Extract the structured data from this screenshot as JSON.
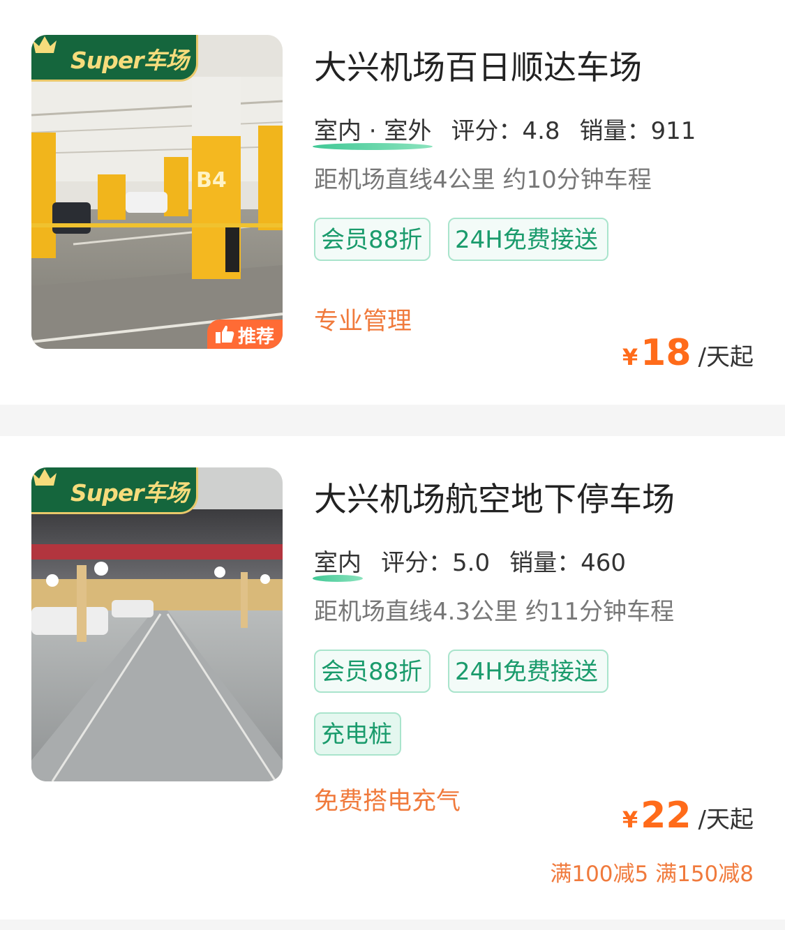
{
  "lots": [
    {
      "name": "大兴机场百日顺达车场",
      "badge": "Super车场",
      "recommend": "推荐",
      "env": "室内 · 室外",
      "rating_label": "评分：4.8",
      "sales_label": "销量：911",
      "distance": "距机场直线4公里 约10分钟车程",
      "tags": [
        "会员88折",
        "24H免费接送"
      ],
      "highlight": "专业管理",
      "currency": "¥",
      "price": "18",
      "price_unit": "/天起"
    },
    {
      "name": "大兴机场航空地下停车场",
      "badge": "Super车场",
      "env": "室内",
      "rating_label": "评分：5.0",
      "sales_label": "销量：460",
      "distance": "距机场直线4.3公里 约11分钟车程",
      "tags": [
        "会员88折",
        "24H免费接送",
        "充电桩"
      ],
      "highlight": "免费搭电充气",
      "currency": "¥",
      "price": "22",
      "price_unit": "/天起",
      "promo": "满100减5 满150减8"
    }
  ],
  "colors": {
    "accent_green": "#1a9b6c",
    "badge_green": "#15663d",
    "price_orange": "#ff6b1a",
    "highlight_orange": "#f07a3c"
  }
}
